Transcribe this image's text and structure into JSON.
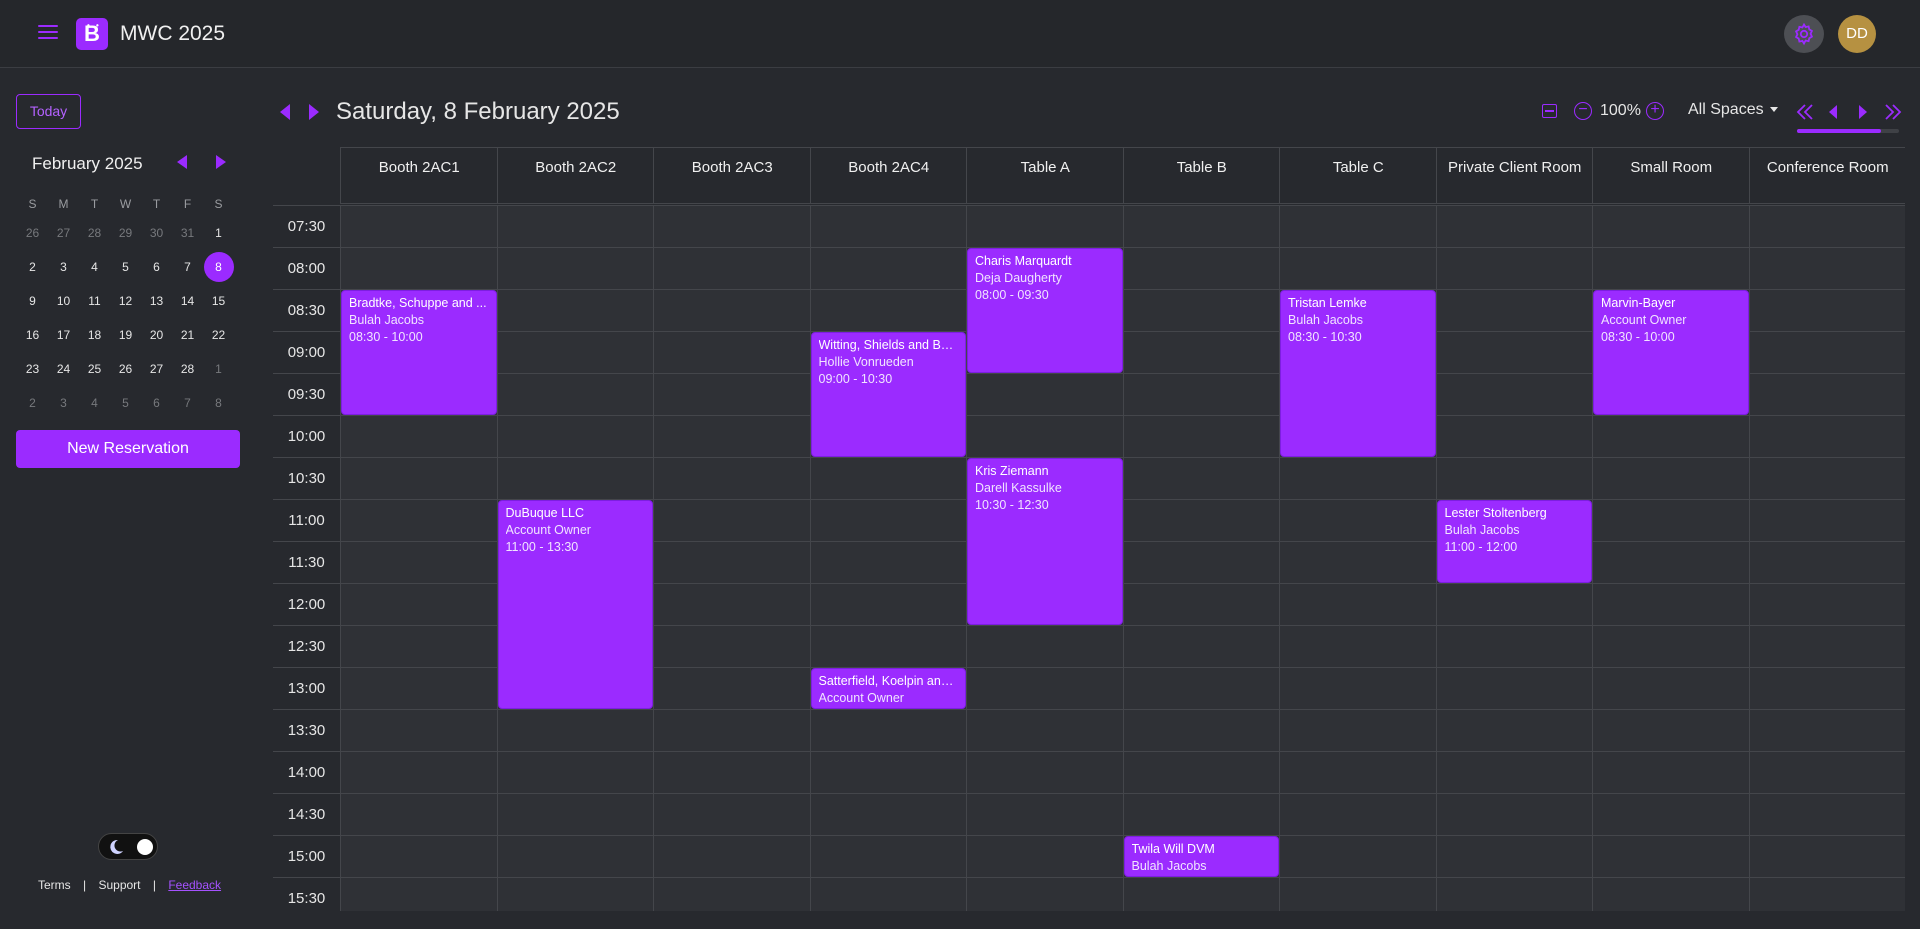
{
  "header": {
    "title": "MWC 2025",
    "avatar_initials": "DD"
  },
  "sidebar": {
    "today_label": "Today",
    "month_title": "February 2025",
    "weekdays": [
      "S",
      "M",
      "T",
      "W",
      "T",
      "F",
      "S"
    ],
    "weeks": [
      [
        [
          "26",
          1
        ],
        [
          "27",
          1
        ],
        [
          "28",
          1
        ],
        [
          "29",
          1
        ],
        [
          "30",
          1
        ],
        [
          "31",
          1
        ],
        [
          "1",
          0
        ]
      ],
      [
        [
          "2",
          0
        ],
        [
          "3",
          0
        ],
        [
          "4",
          0
        ],
        [
          "5",
          0
        ],
        [
          "6",
          0
        ],
        [
          "7",
          0
        ],
        [
          "8",
          2
        ]
      ],
      [
        [
          "9",
          0
        ],
        [
          "10",
          0
        ],
        [
          "11",
          0
        ],
        [
          "12",
          0
        ],
        [
          "13",
          0
        ],
        [
          "14",
          0
        ],
        [
          "15",
          0
        ]
      ],
      [
        [
          "16",
          0
        ],
        [
          "17",
          0
        ],
        [
          "18",
          0
        ],
        [
          "19",
          0
        ],
        [
          "20",
          0
        ],
        [
          "21",
          0
        ],
        [
          "22",
          0
        ]
      ],
      [
        [
          "23",
          0
        ],
        [
          "24",
          0
        ],
        [
          "25",
          0
        ],
        [
          "26",
          0
        ],
        [
          "27",
          0
        ],
        [
          "28",
          0
        ],
        [
          "1",
          1
        ]
      ],
      [
        [
          "2",
          1
        ],
        [
          "3",
          1
        ],
        [
          "4",
          1
        ],
        [
          "5",
          1
        ],
        [
          "6",
          1
        ],
        [
          "7",
          1
        ],
        [
          "8",
          1
        ]
      ]
    ],
    "new_reservation_label": "New Reservation",
    "footer": {
      "terms": "Terms",
      "support": "Support",
      "feedback": "Feedback",
      "separator": "|"
    }
  },
  "calendar": {
    "date_title": "Saturday, 8 February 2025",
    "zoom_level": "100%",
    "spaces_filter": "All Spaces",
    "scroll_progress": 0.82,
    "columns": [
      "Booth 2AC1",
      "Booth 2AC2",
      "Booth 2AC3",
      "Booth 2AC4",
      "Table A",
      "Table B",
      "Table C",
      "Private Client Room",
      "Small Room",
      "Conference Room"
    ],
    "times": [
      "07:30",
      "08:00",
      "08:30",
      "09:00",
      "09:30",
      "10:00",
      "10:30",
      "11:00",
      "11:30",
      "12:00",
      "12:30",
      "13:00",
      "13:30",
      "14:00",
      "14:30",
      "15:00",
      "15:30"
    ],
    "events": [
      {
        "col": 0,
        "start": 2,
        "span": 3,
        "title": "Bradtke, Schuppe and ...",
        "subtitle": "Bulah Jacobs",
        "time": "08:30 - 10:00"
      },
      {
        "col": 1,
        "start": 7,
        "span": 5,
        "title": "DuBuque LLC",
        "subtitle": "Account Owner",
        "time": "11:00 - 13:30"
      },
      {
        "col": 3,
        "start": 3,
        "span": 3,
        "title": "Witting, Shields and Be...",
        "subtitle": "Hollie Vonrueden",
        "time": "09:00 - 10:30"
      },
      {
        "col": 3,
        "start": 11,
        "span": 1,
        "title": "Satterfield, Koelpin and...",
        "subtitle": "Account Owner",
        "time": ""
      },
      {
        "col": 4,
        "start": 1,
        "span": 3,
        "title": "Charis Marquardt",
        "subtitle": "Deja Daugherty",
        "time": "08:00 - 09:30"
      },
      {
        "col": 4,
        "start": 6,
        "span": 4,
        "title": "Kris Ziemann",
        "subtitle": "Darell Kassulke",
        "time": "10:30 - 12:30"
      },
      {
        "col": 5,
        "start": 15,
        "span": 1,
        "title": "Twila Will DVM",
        "subtitle": "Bulah Jacobs",
        "time": ""
      },
      {
        "col": 6,
        "start": 2,
        "span": 4,
        "title": "Tristan Lemke",
        "subtitle": "Bulah Jacobs",
        "time": "08:30 - 10:30"
      },
      {
        "col": 7,
        "start": 7,
        "span": 2,
        "title": "Lester Stoltenberg",
        "subtitle": "Bulah Jacobs",
        "time": "11:00 - 12:00"
      },
      {
        "col": 8,
        "start": 2,
        "span": 3,
        "title": "Marvin-Bayer",
        "subtitle": "Account Owner",
        "time": "08:30 - 10:00"
      }
    ]
  },
  "colors": {
    "accent": "#9b2bff",
    "background": "#27292e",
    "cell": "#2f3136",
    "avatar": "#b69141"
  }
}
